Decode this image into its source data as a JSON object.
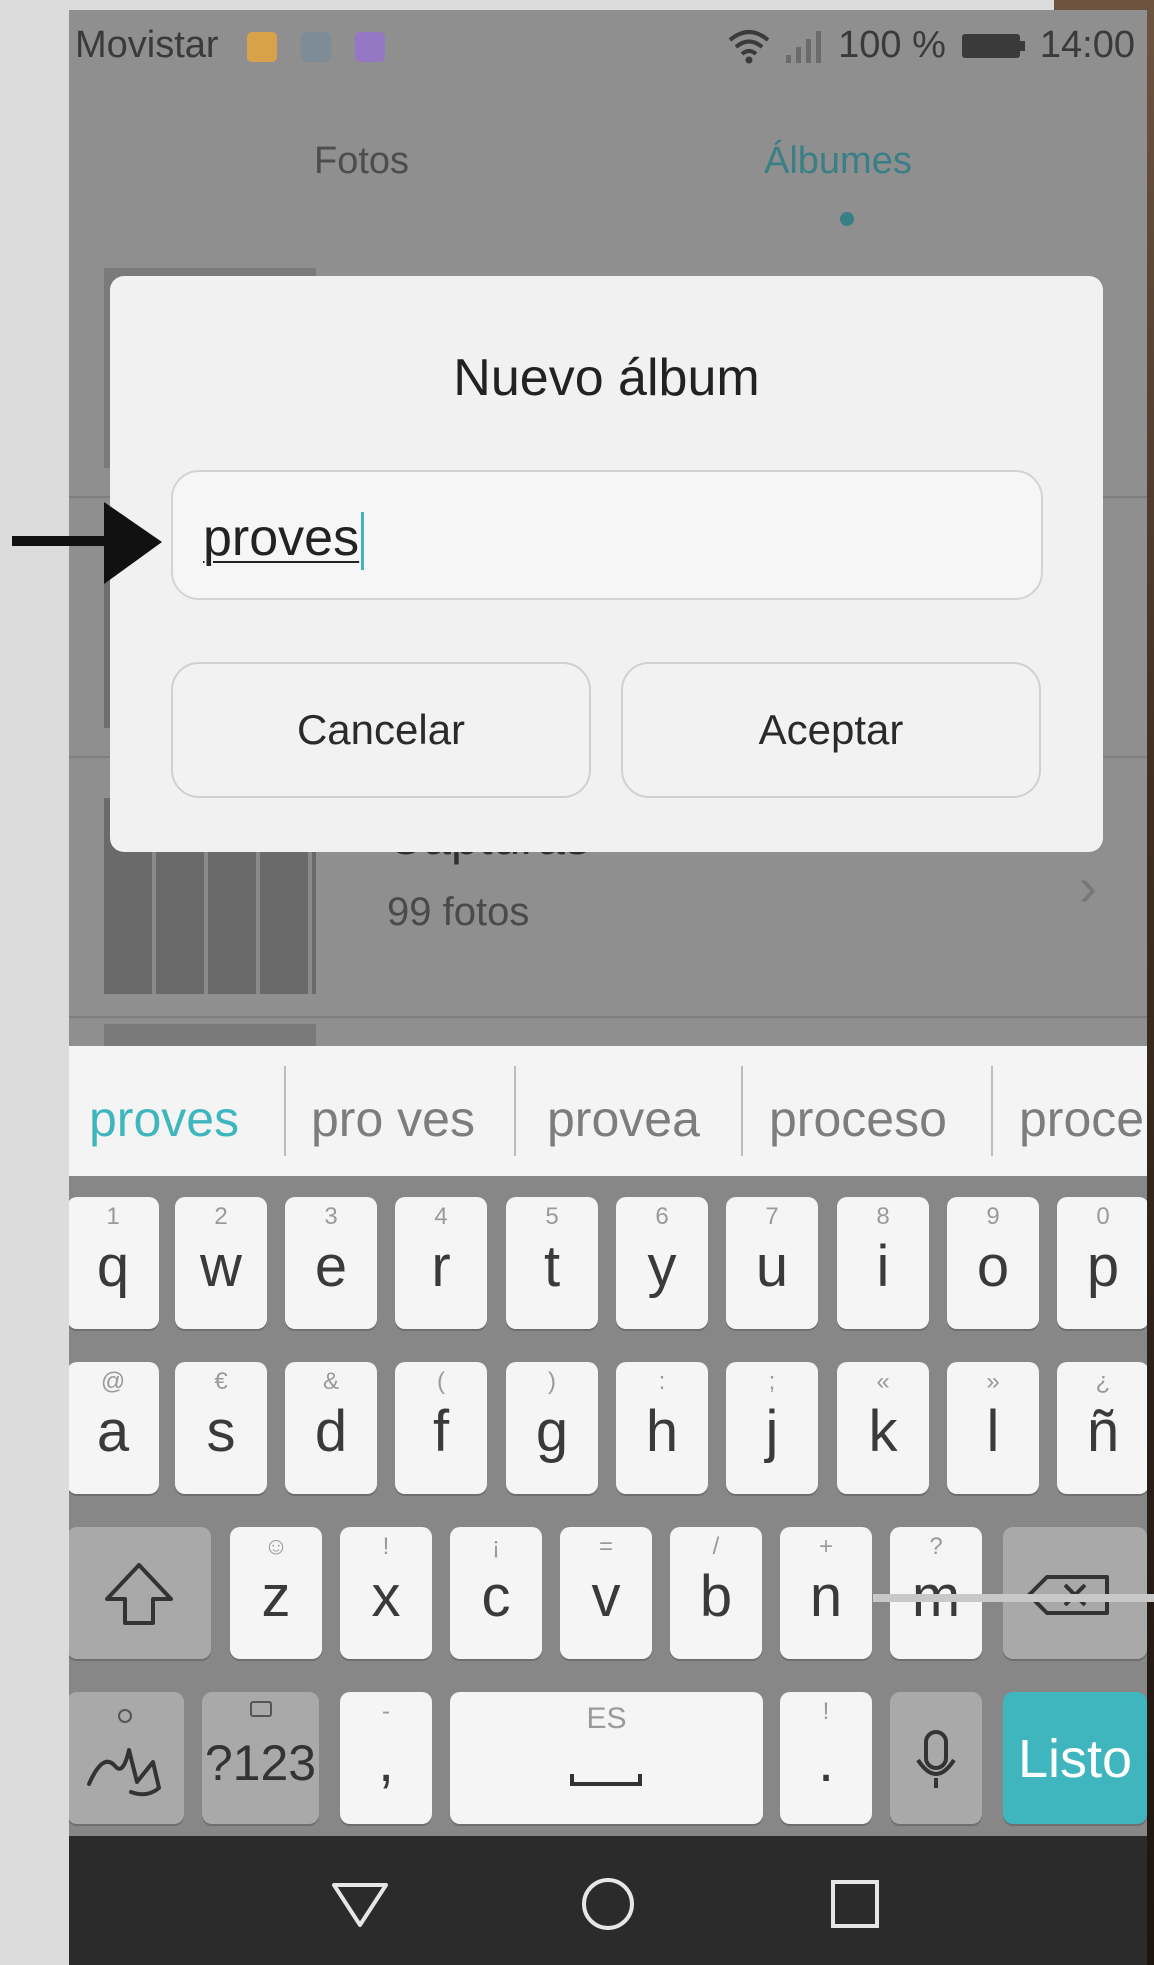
{
  "status_bar": {
    "carrier": "Movistar",
    "battery": "100 %",
    "time": "14:00",
    "icons": [
      "keyboard-notif-icon",
      "image-notif-icon",
      "message-notif-icon",
      "wifi-icon",
      "signal-icon",
      "battery-icon"
    ]
  },
  "tabs": [
    {
      "label": "Fotos",
      "active": false
    },
    {
      "label": "Álbumes",
      "active": true
    }
  ],
  "albums": [
    {
      "name": "Capturas",
      "count": "99 fotos"
    }
  ],
  "dialog": {
    "title": "Nuevo álbum",
    "input_value": "proves",
    "cancel_label": "Cancelar",
    "accept_label": "Aceptar"
  },
  "suggestions": [
    "proves",
    "pro ves",
    "provea",
    "proceso",
    "proce"
  ],
  "keyboard": {
    "row1": [
      [
        "q",
        "1"
      ],
      [
        "w",
        "2"
      ],
      [
        "e",
        "3"
      ],
      [
        "r",
        "4"
      ],
      [
        "t",
        "5"
      ],
      [
        "y",
        "6"
      ],
      [
        "u",
        "7"
      ],
      [
        "i",
        "8"
      ],
      [
        "o",
        "9"
      ],
      [
        "p",
        "0"
      ]
    ],
    "row2": [
      [
        "a",
        "@"
      ],
      [
        "s",
        "€"
      ],
      [
        "d",
        "&"
      ],
      [
        "f",
        "("
      ],
      [
        "g",
        ")"
      ],
      [
        "h",
        ":"
      ],
      [
        "j",
        ";"
      ],
      [
        "k",
        "«"
      ],
      [
        "l",
        "»"
      ],
      [
        "ñ",
        "¿"
      ]
    ],
    "row3": [
      [
        "z",
        "☺"
      ],
      [
        "x",
        "!"
      ],
      [
        "c",
        "¡"
      ],
      [
        "v",
        "="
      ],
      [
        "b",
        "/"
      ],
      [
        "n",
        "+"
      ],
      [
        "m",
        "?"
      ]
    ],
    "symbols_label": "?123",
    "comma": ",",
    "comma_alt": "-",
    "space_lang": "ES",
    "period": ".",
    "period_alt": "!",
    "done_label": "Listo"
  },
  "colors": {
    "accent": "#3fb6bd",
    "tab_active": "#3a7f86"
  }
}
